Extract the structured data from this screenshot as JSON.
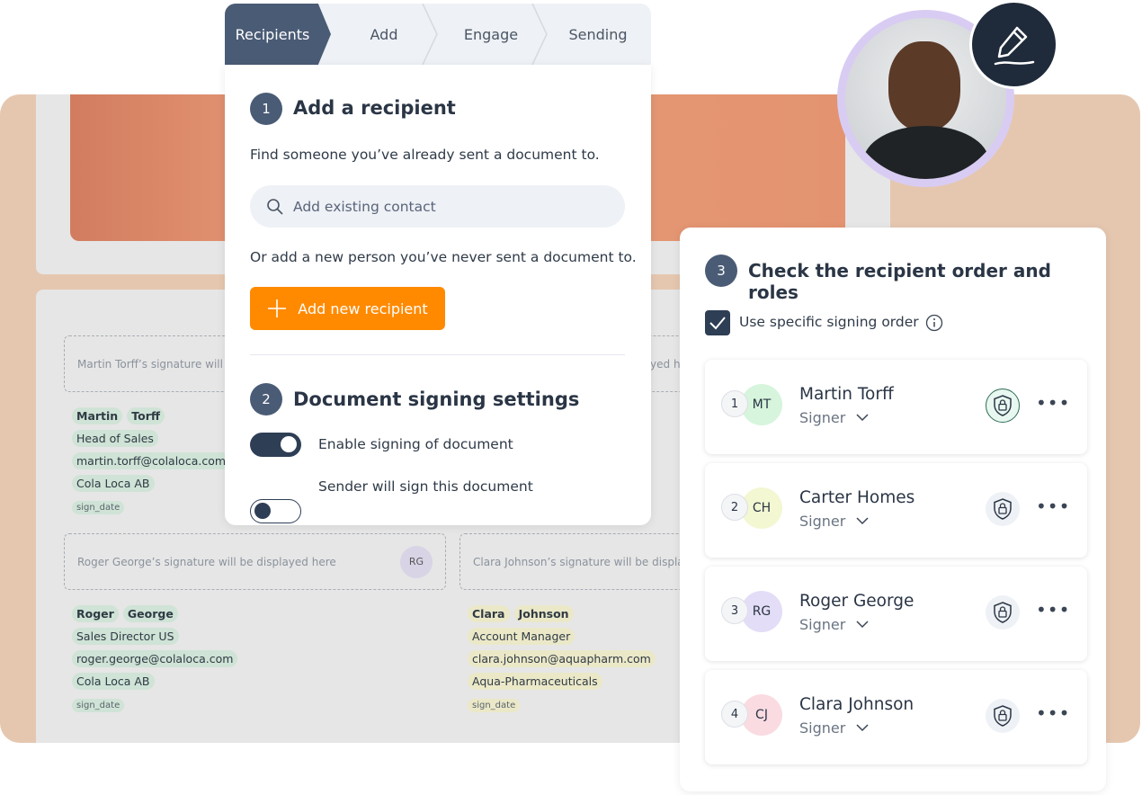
{
  "stepper": [
    "Recipients",
    "Add",
    "Engage",
    "Sending"
  ],
  "section1": {
    "number": "1",
    "title": "Add a recipient",
    "description": "Find someone you’ve already sent a document to.",
    "search_placeholder": "Add existing contact",
    "or_text": "Or add a new person you’ve never sent a document to.",
    "add_button": "Add new recipient"
  },
  "section2": {
    "number": "2",
    "title": "Document signing settings",
    "toggles": [
      {
        "label": "Enable signing of document",
        "on": true
      },
      {
        "label": "Sender will sign this document",
        "on": false
      }
    ]
  },
  "section3": {
    "number": "3",
    "title": "Check the recipient order and roles",
    "checkbox_label": "Use specific signing order",
    "checked": true,
    "recipients": [
      {
        "order": "1",
        "initials": "MT",
        "name": "Martin Torff",
        "role": "Signer",
        "color": "#d6f5dc",
        "lock_active": true
      },
      {
        "order": "2",
        "initials": "CH",
        "name": "Carter Homes",
        "role": "Signer",
        "color": "#f3f7d2",
        "lock_active": false
      },
      {
        "order": "3",
        "initials": "RG",
        "name": "Roger George",
        "role": "Signer",
        "color": "#e3ddf7",
        "lock_active": false
      },
      {
        "order": "4",
        "initials": "CJ",
        "name": "Clara Johnson",
        "role": "Signer",
        "color": "#fadbe2",
        "lock_active": false
      }
    ]
  },
  "document": {
    "sig1": {
      "placeholder": "Martin Torff’s signature will be displayed here",
      "first": "Martin",
      "last": "Torff",
      "title": "Head of Sales",
      "email": "martin.torff@colaloca.com",
      "company": "Cola Loca AB",
      "date": "sign_date"
    },
    "sig2": {
      "placeholder": "Roger George’s signature will be displayed here",
      "initials": "RG",
      "first": "Roger",
      "last": "George",
      "title": "Sales Director US",
      "email": "roger.george@colaloca.com",
      "company": "Cola Loca AB",
      "date": "sign_date"
    },
    "sig3": {
      "placeholder": "Clara Johnson’s signature will be displayed here",
      "first": "Clara",
      "last": "Johnson",
      "title": "Account Manager",
      "email": "clara.johnson@aquapharm.com",
      "company": "Aqua-Pharmaceuticals",
      "date": "sign_date"
    },
    "sig_right_partial": "Carter Homes’ signature will be displayed here"
  },
  "colors": {
    "accent": "#ff8a00",
    "primary": "#4a5b75",
    "tag": "#cfe3d6",
    "avatar_ring": "#d9ccf3"
  }
}
